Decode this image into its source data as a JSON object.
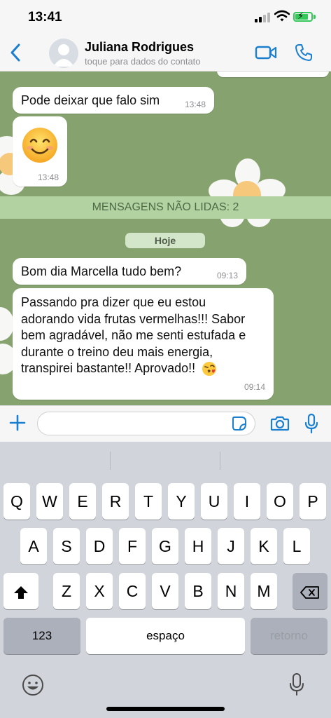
{
  "status_bar": {
    "time": "13:41"
  },
  "header": {
    "contact_name": "Juliana Rodrigues",
    "subtitle": "toque para dados do contato",
    "icons": [
      "back-arrow-icon",
      "avatar-icon",
      "video-call-icon",
      "phone-icon"
    ]
  },
  "colors": {
    "chat_background": "#86a26f",
    "accent": "#1a7fcf",
    "bubble": "#ffffff"
  },
  "messages": [
    {
      "text": "Pode deixar que falo sim",
      "time": "13:48"
    },
    {
      "emoji": "smiling-face-emoji",
      "time": "13:48"
    },
    {
      "text": "Bom dia Marcella tudo bem?",
      "time": "09:13"
    },
    {
      "lines": [
        "Passando pra dizer que eu estou",
        "adorando vida frutas vermelhas!!! Sabor",
        "bem agradável, não me senti estufada e",
        "durante o treino deu mais energia,",
        "transpirei bastante!! Aprovado!!"
      ],
      "emoji": "face-blowing-kiss-emoji",
      "time": "09:14"
    }
  ],
  "unread_banner": "MENSAGENS NÃO LIDAS: 2",
  "date_separator": "Hoje",
  "keyboard": {
    "row1": [
      "Q",
      "W",
      "E",
      "R",
      "T",
      "Y",
      "U",
      "I",
      "O",
      "P"
    ],
    "row2": [
      "A",
      "S",
      "D",
      "F",
      "G",
      "H",
      "J",
      "K",
      "L"
    ],
    "row3": [
      "Z",
      "X",
      "C",
      "V",
      "B",
      "N",
      "M"
    ],
    "numbers_key": "123",
    "space_key": "espaço",
    "return_key": "retorno"
  }
}
